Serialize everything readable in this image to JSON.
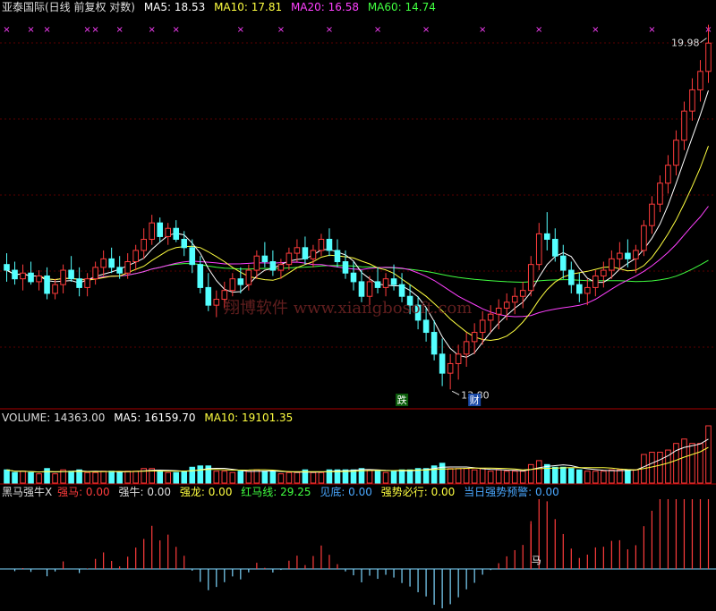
{
  "colors": {
    "up": "#ff3c3c",
    "down": "#54ffff",
    "ma5": "#ffffff",
    "ma10": "#ffff40",
    "ma20": "#ff40ff",
    "ma60": "#40ff40",
    "label_white": "#dddddd",
    "divider": "#aa0000",
    "x_marker": "#ff40ff",
    "bull_red": "#ff3c3c",
    "bull_blue": "#4aa8ff"
  },
  "main_legend": {
    "title": "亚泰国际(日线 前复权 对数)",
    "ma5": "MA5: 18.53",
    "ma10": "MA10: 17.81",
    "ma20": "MA20: 16.58",
    "ma60": "MA60: 14.74"
  },
  "volume_legend": {
    "label": "VOLUME: 14363.00",
    "ma5": "MA5: 16159.70",
    "ma10": "MA10: 19101.35"
  },
  "indicator_legend": {
    "name": "黑马强牛X",
    "qiangma": "强马: 0.00",
    "qiangniu": "强牛: 0.00",
    "qianglong": "强龙: 0.00",
    "hongmaxian": "红马线: 29.25",
    "jiandi": "见底: 0.00",
    "qiangshi": "强势必行: 0.00",
    "yujing": "当日强势预警: 0.00"
  },
  "annotations": {
    "high_price": "19.98",
    "low_price": "13.80",
    "die_marker": "跌",
    "cai_marker": "财",
    "ma_marker": "马",
    "watermark": "翔博软件 www.xiangbosoft.com"
  },
  "chart_data": {
    "type": "candlestick",
    "price_range": [
      13.3,
      20.6
    ],
    "log_scale": true,
    "candles": [
      [
        15.55,
        15.75,
        15.25,
        15.45
      ],
      [
        15.45,
        15.6,
        15.2,
        15.3
      ],
      [
        15.3,
        15.55,
        15.1,
        15.4
      ],
      [
        15.4,
        15.6,
        15.2,
        15.25
      ],
      [
        15.25,
        15.45,
        15.1,
        15.35
      ],
      [
        15.35,
        15.5,
        14.95,
        15.05
      ],
      [
        15.05,
        15.3,
        14.95,
        15.2
      ],
      [
        15.2,
        15.55,
        15.05,
        15.45
      ],
      [
        15.45,
        15.7,
        15.25,
        15.3
      ],
      [
        15.3,
        15.5,
        15.0,
        15.15
      ],
      [
        15.15,
        15.4,
        15.0,
        15.3
      ],
      [
        15.3,
        15.6,
        15.2,
        15.5
      ],
      [
        15.5,
        15.8,
        15.35,
        15.65
      ],
      [
        15.65,
        15.85,
        15.4,
        15.5
      ],
      [
        15.5,
        15.7,
        15.3,
        15.4
      ],
      [
        15.4,
        15.75,
        15.3,
        15.6
      ],
      [
        15.6,
        15.9,
        15.45,
        15.8
      ],
      [
        15.8,
        16.2,
        15.65,
        16.0
      ],
      [
        16.0,
        16.45,
        15.9,
        16.3
      ],
      [
        16.3,
        16.4,
        15.95,
        16.05
      ],
      [
        16.05,
        16.3,
        15.9,
        16.2
      ],
      [
        16.2,
        16.35,
        15.95,
        16.0
      ],
      [
        16.0,
        16.15,
        15.7,
        15.85
      ],
      [
        15.85,
        16.0,
        15.4,
        15.55
      ],
      [
        15.55,
        15.7,
        15.05,
        15.15
      ],
      [
        15.15,
        15.4,
        14.75,
        14.85
      ],
      [
        14.85,
        15.1,
        14.65,
        14.95
      ],
      [
        14.95,
        15.25,
        14.8,
        15.1
      ],
      [
        15.1,
        15.4,
        15.0,
        15.3
      ],
      [
        15.3,
        15.5,
        15.05,
        15.2
      ],
      [
        15.2,
        15.55,
        15.1,
        15.45
      ],
      [
        15.45,
        15.8,
        15.3,
        15.7
      ],
      [
        15.7,
        15.95,
        15.5,
        15.6
      ],
      [
        15.6,
        15.8,
        15.35,
        15.45
      ],
      [
        15.45,
        15.65,
        15.3,
        15.55
      ],
      [
        15.55,
        15.85,
        15.45,
        15.75
      ],
      [
        15.75,
        16.0,
        15.6,
        15.85
      ],
      [
        15.85,
        16.05,
        15.55,
        15.65
      ],
      [
        15.65,
        15.9,
        15.5,
        15.8
      ],
      [
        15.8,
        16.1,
        15.7,
        16.0
      ],
      [
        16.0,
        16.2,
        15.7,
        15.8
      ],
      [
        15.8,
        16.0,
        15.5,
        15.6
      ],
      [
        15.6,
        15.8,
        15.3,
        15.4
      ],
      [
        15.4,
        15.6,
        15.1,
        15.25
      ],
      [
        15.25,
        15.45,
        14.9,
        15.0
      ],
      [
        15.0,
        15.35,
        14.85,
        15.25
      ],
      [
        15.25,
        15.5,
        15.05,
        15.15
      ],
      [
        15.15,
        15.4,
        15.0,
        15.3
      ],
      [
        15.3,
        15.55,
        15.1,
        15.2
      ],
      [
        15.2,
        15.4,
        14.9,
        15.0
      ],
      [
        15.0,
        15.2,
        14.7,
        14.85
      ],
      [
        14.85,
        15.0,
        14.45,
        14.6
      ],
      [
        14.6,
        14.8,
        14.25,
        14.4
      ],
      [
        14.4,
        14.6,
        13.95,
        14.05
      ],
      [
        14.05,
        14.3,
        13.55,
        13.75
      ],
      [
        13.75,
        14.05,
        13.5,
        13.9
      ],
      [
        13.9,
        14.2,
        13.65,
        14.05
      ],
      [
        14.05,
        14.4,
        13.85,
        14.25
      ],
      [
        14.25,
        14.55,
        14.05,
        14.4
      ],
      [
        14.4,
        14.75,
        14.2,
        14.6
      ],
      [
        14.6,
        14.85,
        14.4,
        14.7
      ],
      [
        14.7,
        14.95,
        14.45,
        14.8
      ],
      [
        14.8,
        15.05,
        14.6,
        14.9
      ],
      [
        14.9,
        15.15,
        14.7,
        15.0
      ],
      [
        15.0,
        15.25,
        14.8,
        15.1
      ],
      [
        15.1,
        15.7,
        15.0,
        15.55
      ],
      [
        15.55,
        16.3,
        15.45,
        16.1
      ],
      [
        16.1,
        16.5,
        15.8,
        16.0
      ],
      [
        16.0,
        16.2,
        15.6,
        15.7
      ],
      [
        15.7,
        15.9,
        15.3,
        15.45
      ],
      [
        15.45,
        15.6,
        15.05,
        15.2
      ],
      [
        15.2,
        15.4,
        14.9,
        15.05
      ],
      [
        15.05,
        15.3,
        14.85,
        15.15
      ],
      [
        15.15,
        15.45,
        15.0,
        15.35
      ],
      [
        15.35,
        15.6,
        15.15,
        15.45
      ],
      [
        15.45,
        15.8,
        15.3,
        15.65
      ],
      [
        15.65,
        15.95,
        15.45,
        15.75
      ],
      [
        15.75,
        16.0,
        15.5,
        15.65
      ],
      [
        15.65,
        15.9,
        15.4,
        15.8
      ],
      [
        15.8,
        16.35,
        15.7,
        16.25
      ],
      [
        16.25,
        16.8,
        16.1,
        16.65
      ],
      [
        16.65,
        17.2,
        16.5,
        17.05
      ],
      [
        17.05,
        17.6,
        16.85,
        17.4
      ],
      [
        17.4,
        18.1,
        17.2,
        17.9
      ],
      [
        17.9,
        18.7,
        17.7,
        18.5
      ],
      [
        18.5,
        19.2,
        18.3,
        18.95
      ],
      [
        18.95,
        19.6,
        18.7,
        19.35
      ],
      [
        19.35,
        20.4,
        19.1,
        19.98
      ]
    ]
  }
}
